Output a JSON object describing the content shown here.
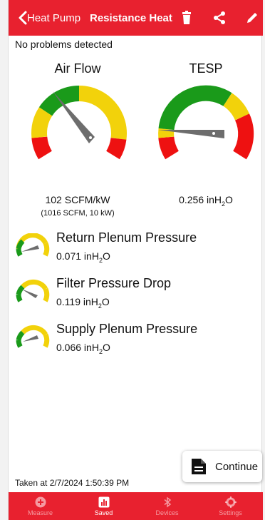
{
  "header": {
    "back_label": "Heat Pump",
    "title": "Resistance Heat"
  },
  "status_text": "No problems detected",
  "gauges": {
    "airflow": {
      "title": "Air Flow",
      "reading": "102 SCFM/kW",
      "subreading": "(1016 SCFM, 10 kW)"
    },
    "tesp": {
      "title": "TESP",
      "reading_value": "0.256 inH",
      "reading_sub": "2",
      "reading_suffix": "O"
    }
  },
  "pressures": [
    {
      "title": "Return Plenum Pressure",
      "value": "0.071 inH",
      "sub": "2",
      "suffix": "O"
    },
    {
      "title": "Filter Pressure Drop",
      "value": "0.119 inH",
      "sub": "2",
      "suffix": "O"
    },
    {
      "title": "Supply Plenum Pressure",
      "value": "0.066 inH",
      "sub": "2",
      "suffix": "O"
    }
  ],
  "continue_label": "Continue",
  "taken_text": "Taken at 2/7/2024 1:50:39 PM",
  "tabs": [
    {
      "label": "Measure",
      "icon": "plus-circle-icon",
      "active": false
    },
    {
      "label": "Saved",
      "icon": "bar-chart-icon",
      "active": true
    },
    {
      "label": "Devices",
      "icon": "bluetooth-icon",
      "active": false
    },
    {
      "label": "Settings",
      "icon": "gear-icon",
      "active": false
    }
  ],
  "colors": {
    "brand_red": "#e8212f",
    "gauge_green": "#1a9a1a",
    "gauge_yellow": "#f2d20b",
    "gauge_red": "#ee1111",
    "needle": "#6d6d6d"
  }
}
